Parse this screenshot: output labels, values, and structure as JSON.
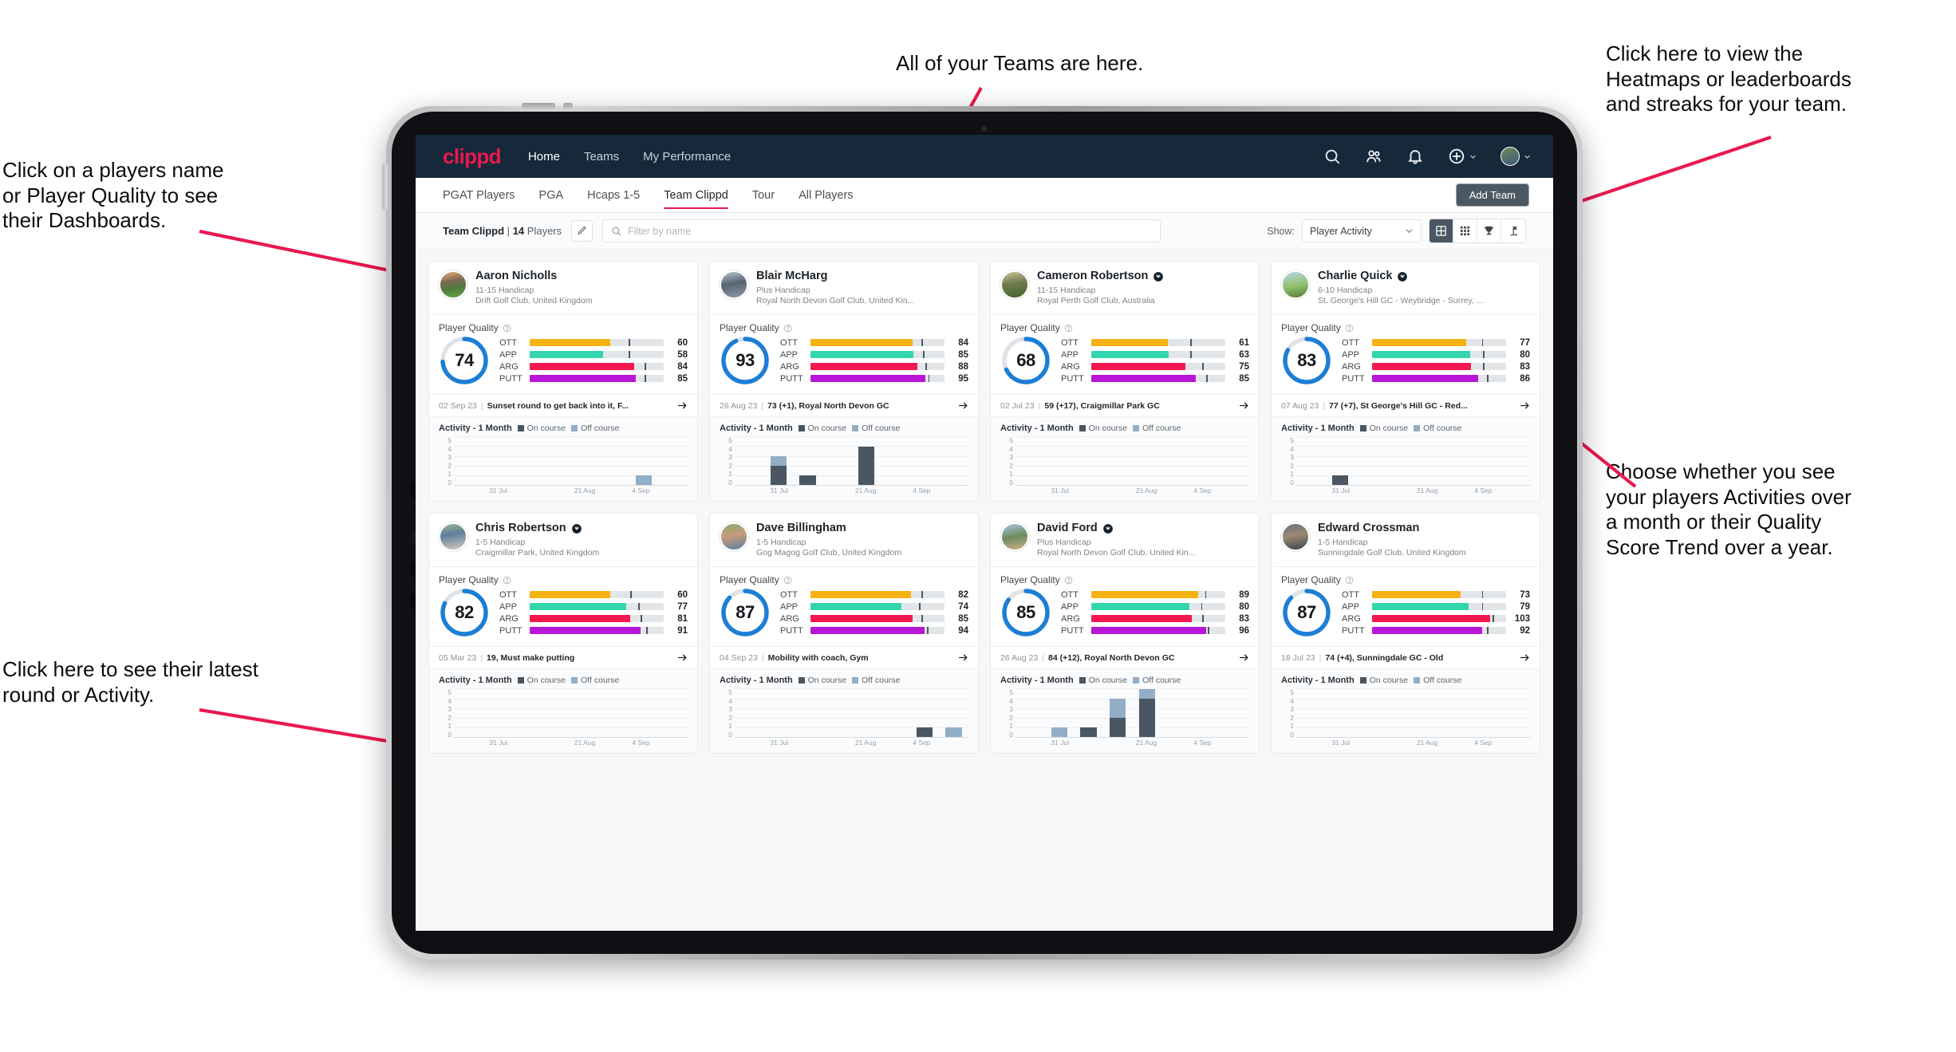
{
  "annotations": {
    "top": "All of your Teams are here.",
    "top_right": "Click here to view the\nHeatmaps or leaderboards\nand streaks for your team.",
    "left": "Click on a players name\nor Player Quality to see\ntheir Dashboards.",
    "right": "Choose whether you see\nyour players Activities over\na month or their Quality\nScore Trend over a year.",
    "bottom_left": "Click here to see their latest\nround or Activity.",
    "arrow_color": "#e8194f"
  },
  "topnav": {
    "logo": "clippd",
    "links": [
      {
        "label": "Home",
        "active": true
      },
      {
        "label": "Teams",
        "active": false
      },
      {
        "label": "My Performance",
        "active": false
      }
    ],
    "icons": [
      "search-icon",
      "people-icon",
      "bell-icon",
      "plus-circle-icon",
      "avatar"
    ]
  },
  "tabs": [
    {
      "label": "PGAT Players",
      "active": false
    },
    {
      "label": "PGA",
      "active": false
    },
    {
      "label": "Hcaps 1-5",
      "active": false
    },
    {
      "label": "Team Clippd",
      "active": true
    },
    {
      "label": "Tour",
      "active": false
    },
    {
      "label": "All Players",
      "active": false
    }
  ],
  "add_team_label": "Add Team",
  "filterbar": {
    "team_name": "Team Clippd",
    "separator": "|",
    "player_count": "14",
    "players_word": "Players",
    "search_placeholder": "Filter by name",
    "search_value": "",
    "show_label": "Show:",
    "show_value": "Player Activity",
    "show_options": [
      "Player Activity",
      "Quality Score Trend"
    ],
    "views": [
      {
        "name": "grid-view-icon",
        "active": true
      },
      {
        "name": "heatmap-view-icon",
        "active": false
      },
      {
        "name": "leaderboard-trophy-icon",
        "active": false
      },
      {
        "name": "streaks-flag-icon",
        "active": false
      }
    ]
  },
  "card_labels": {
    "player_quality": "Player Quality",
    "activity": "Activity - 1 Month",
    "legend_on": "On course",
    "legend_off": "Off course"
  },
  "metric_colors": {
    "OTT": "#f5b212",
    "APP": "#33d6ac",
    "ARG": "#f5174e",
    "PUTT": "#b816d6",
    "track": "#e3e6e9",
    "gauge": "#1c7ed6",
    "gauge_bg": "#dfe3e7"
  },
  "chart_axis": {
    "y_ticks": [
      "0",
      "1",
      "2",
      "3",
      "4",
      "5"
    ],
    "y_max": 5,
    "x_ticks": [
      "31 Jul",
      "21 Aug",
      "4 Sep"
    ]
  },
  "players": [
    {
      "name": "Aaron Nicholls",
      "verified": false,
      "avatar_class": "av1",
      "handicap": "11-15 Handicap",
      "club": "Drift Golf Club, United Kingdom",
      "quality": 74,
      "metrics": [
        {
          "label": "OTT",
          "value": 60,
          "fill": 60,
          "tick": 74
        },
        {
          "label": "APP",
          "value": 58,
          "fill": 55,
          "tick": 74
        },
        {
          "label": "ARG",
          "value": 84,
          "fill": 78,
          "tick": 86
        },
        {
          "label": "PUTT",
          "value": 85,
          "fill": 79,
          "tick": 86
        }
      ],
      "round_date": "02 Sep 23",
      "round_text": "Sunset round to get back into it, F...",
      "chart_data": {
        "type": "bar",
        "categories": [
          "31 Jul",
          "21 Aug",
          "4 Sep"
        ],
        "series": [
          {
            "name": "On course",
            "values": [
              0,
              0,
              0,
              0,
              0,
              0,
              0,
              0
            ]
          },
          {
            "name": "Off course",
            "values": [
              0,
              0,
              0,
              0,
              0,
              0,
              1,
              0
            ]
          }
        ],
        "ylim": [
          0,
          5
        ]
      }
    },
    {
      "name": "Blair McHarg",
      "verified": false,
      "avatar_class": "av2",
      "handicap": "Plus Handicap",
      "club": "Royal North Devon Golf Club, United Kin...",
      "quality": 93,
      "metrics": [
        {
          "label": "OTT",
          "value": 84,
          "fill": 76,
          "tick": 83
        },
        {
          "label": "APP",
          "value": 85,
          "fill": 77,
          "tick": 84
        },
        {
          "label": "ARG",
          "value": 88,
          "fill": 80,
          "tick": 86
        },
        {
          "label": "PUTT",
          "value": 95,
          "fill": 86,
          "tick": 88
        }
      ],
      "round_date": "26 Aug 23",
      "round_text": "73 (+1), Royal North Devon GC",
      "chart_data": {
        "type": "bar",
        "categories": [
          "31 Jul",
          "21 Aug",
          "4 Sep"
        ],
        "series": [
          {
            "name": "On course",
            "values": [
              0,
              2,
              1,
              0,
              4,
              0,
              0,
              0
            ]
          },
          {
            "name": "Off course",
            "values": [
              0,
              1,
              0,
              0,
              0,
              0,
              0,
              0
            ]
          }
        ],
        "ylim": [
          0,
          5
        ]
      }
    },
    {
      "name": "Cameron Robertson",
      "verified": true,
      "avatar_class": "av3",
      "handicap": "11-15 Handicap",
      "club": "Royal Perth Golf Club, Australia",
      "quality": 68,
      "metrics": [
        {
          "label": "OTT",
          "value": 61,
          "fill": 57,
          "tick": 74
        },
        {
          "label": "APP",
          "value": 63,
          "fill": 58,
          "tick": 74
        },
        {
          "label": "ARG",
          "value": 75,
          "fill": 70,
          "tick": 83
        },
        {
          "label": "PUTT",
          "value": 85,
          "fill": 78,
          "tick": 86
        }
      ],
      "round_date": "02 Jul 23",
      "round_text": "59 (+17), Craigmillar Park GC",
      "chart_data": {
        "type": "bar",
        "categories": [
          "31 Jul",
          "21 Aug",
          "4 Sep"
        ],
        "series": [
          {
            "name": "On course",
            "values": [
              0,
              0,
              0,
              0,
              0,
              0,
              0,
              0
            ]
          },
          {
            "name": "Off course",
            "values": [
              0,
              0,
              0,
              0,
              0,
              0,
              0,
              0
            ]
          }
        ],
        "ylim": [
          0,
          5
        ]
      }
    },
    {
      "name": "Charlie Quick",
      "verified": true,
      "avatar_class": "av4",
      "handicap": "6-10 Handicap",
      "club": "St. George's Hill GC - Weybridge - Surrey, ...",
      "quality": 83,
      "metrics": [
        {
          "label": "OTT",
          "value": 77,
          "fill": 70,
          "tick": 82
        },
        {
          "label": "APP",
          "value": 80,
          "fill": 73,
          "tick": 83
        },
        {
          "label": "ARG",
          "value": 83,
          "fill": 74,
          "tick": 83
        },
        {
          "label": "PUTT",
          "value": 86,
          "fill": 79,
          "tick": 86
        }
      ],
      "round_date": "07 Aug 23",
      "round_text": "77 (+7), St George's Hill GC - Red...",
      "chart_data": {
        "type": "bar",
        "categories": [
          "31 Jul",
          "21 Aug",
          "4 Sep"
        ],
        "series": [
          {
            "name": "On course",
            "values": [
              0,
              1,
              0,
              0,
              0,
              0,
              0,
              0
            ]
          },
          {
            "name": "Off course",
            "values": [
              0,
              0,
              0,
              0,
              0,
              0,
              0,
              0
            ]
          }
        ],
        "ylim": [
          0,
          5
        ]
      }
    },
    {
      "name": "Chris Robertson",
      "verified": true,
      "avatar_class": "av5",
      "handicap": "1-5 Handicap",
      "club": "Craigmillar Park, United Kingdom",
      "quality": 82,
      "metrics": [
        {
          "label": "OTT",
          "value": 60,
          "fill": 60,
          "tick": 75
        },
        {
          "label": "APP",
          "value": 77,
          "fill": 72,
          "tick": 81
        },
        {
          "label": "ARG",
          "value": 81,
          "fill": 75,
          "tick": 83
        },
        {
          "label": "PUTT",
          "value": 91,
          "fill": 83,
          "tick": 87
        }
      ],
      "round_date": "05 Mar 23",
      "round_text": "19, Must make putting",
      "chart_data": {
        "type": "bar",
        "categories": [
          "31 Jul",
          "21 Aug",
          "4 Sep"
        ],
        "series": [
          {
            "name": "On course",
            "values": [
              0,
              0,
              0,
              0,
              0,
              0,
              0,
              0
            ]
          },
          {
            "name": "Off course",
            "values": [
              0,
              0,
              0,
              0,
              0,
              0,
              0,
              0
            ]
          }
        ],
        "ylim": [
          0,
          5
        ]
      }
    },
    {
      "name": "Dave Billingham",
      "verified": false,
      "avatar_class": "av6",
      "handicap": "1-5 Handicap",
      "club": "Gog Magog Golf Club, United Kingdom",
      "quality": 87,
      "metrics": [
        {
          "label": "OTT",
          "value": 82,
          "fill": 75,
          "tick": 83
        },
        {
          "label": "APP",
          "value": 74,
          "fill": 68,
          "tick": 81
        },
        {
          "label": "ARG",
          "value": 85,
          "fill": 76,
          "tick": 83
        },
        {
          "label": "PUTT",
          "value": 94,
          "fill": 85,
          "tick": 87
        }
      ],
      "round_date": "04 Sep 23",
      "round_text": "Mobility with coach, Gym",
      "chart_data": {
        "type": "bar",
        "categories": [
          "31 Jul",
          "21 Aug",
          "4 Sep"
        ],
        "series": [
          {
            "name": "On course",
            "values": [
              0,
              0,
              0,
              0,
              0,
              0,
              1,
              0
            ]
          },
          {
            "name": "Off course",
            "values": [
              0,
              0,
              0,
              0,
              0,
              0,
              0,
              1
            ]
          }
        ],
        "ylim": [
          0,
          5
        ]
      }
    },
    {
      "name": "David Ford",
      "verified": true,
      "avatar_class": "av7",
      "handicap": "Plus Handicap",
      "club": "Royal North Devon Golf Club, United Kin...",
      "quality": 85,
      "metrics": [
        {
          "label": "OTT",
          "value": 89,
          "fill": 80,
          "tick": 85
        },
        {
          "label": "APP",
          "value": 80,
          "fill": 73,
          "tick": 82
        },
        {
          "label": "ARG",
          "value": 83,
          "fill": 75,
          "tick": 83
        },
        {
          "label": "PUTT",
          "value": 96,
          "fill": 86,
          "tick": 87
        }
      ],
      "round_date": "26 Aug 23",
      "round_text": "84 (+12), Royal North Devon GC",
      "chart_data": {
        "type": "bar",
        "categories": [
          "31 Jul",
          "21 Aug",
          "4 Sep"
        ],
        "series": [
          {
            "name": "On course",
            "values": [
              0,
              0,
              1,
              2,
              4,
              0,
              0,
              0
            ]
          },
          {
            "name": "Off course",
            "values": [
              0,
              1,
              0,
              2,
              1,
              0,
              0,
              0
            ]
          }
        ],
        "ylim": [
          0,
          5
        ]
      }
    },
    {
      "name": "Edward Crossman",
      "verified": false,
      "avatar_class": "av8",
      "handicap": "1-5 Handicap",
      "club": "Sunningdale Golf Club, United Kingdom",
      "quality": 87,
      "metrics": [
        {
          "label": "OTT",
          "value": 73,
          "fill": 66,
          "tick": 82
        },
        {
          "label": "APP",
          "value": 79,
          "fill": 72,
          "tick": 82
        },
        {
          "label": "ARG",
          "value": 103,
          "fill": 88,
          "tick": 90
        },
        {
          "label": "PUTT",
          "value": 92,
          "fill": 82,
          "tick": 86
        }
      ],
      "round_date": "18 Jul 23",
      "round_text": "74 (+4), Sunningdale GC - Old",
      "chart_data": {
        "type": "bar",
        "categories": [
          "31 Jul",
          "21 Aug",
          "4 Sep"
        ],
        "series": [
          {
            "name": "On course",
            "values": [
              0,
              0,
              0,
              0,
              0,
              0,
              0,
              0
            ]
          },
          {
            "name": "Off course",
            "values": [
              0,
              0,
              0,
              0,
              0,
              0,
              0,
              0
            ]
          }
        ],
        "ylim": [
          0,
          5
        ]
      }
    }
  ]
}
